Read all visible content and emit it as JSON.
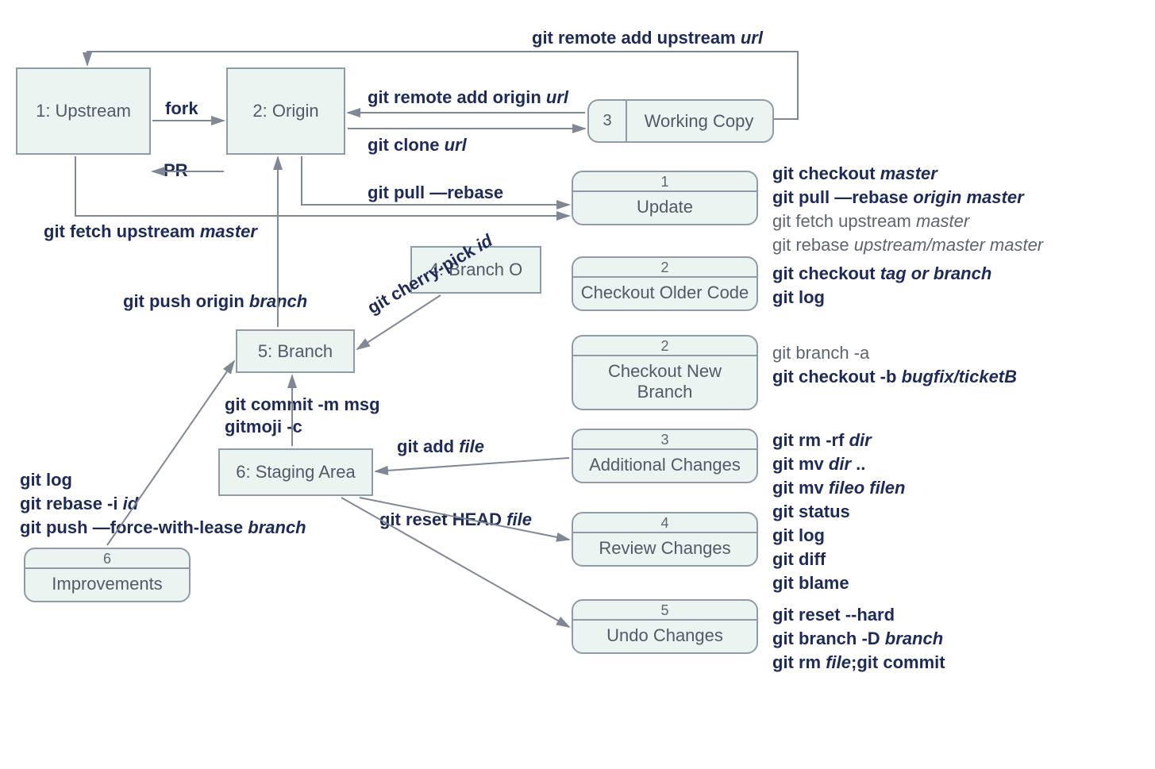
{
  "nodes": {
    "upstream": "1: Upstream",
    "origin": "2: Origin",
    "branchO": "4: Branch O",
    "branch": "5: Branch",
    "staging": "6: Staging Area"
  },
  "wcopy": {
    "num": "3",
    "label": "Working Copy"
  },
  "rightPills": {
    "update": {
      "num": "1",
      "label": "Update"
    },
    "checkoutOld": {
      "num": "2",
      "label": "Checkout Older Code"
    },
    "checkoutNew": {
      "num": "2",
      "label": "Checkout New Branch"
    },
    "addChanges": {
      "num": "3",
      "label": "Additional Changes"
    },
    "reviewChanges": {
      "num": "4",
      "label": "Review Changes"
    },
    "undoChanges": {
      "num": "5",
      "label": "Undo Changes"
    }
  },
  "improvements": {
    "num": "6",
    "label": "Improvements"
  },
  "edge": {
    "remoteUpstream": {
      "cmd": "git remote add upstream ",
      "arg": "url"
    },
    "fork": "fork",
    "remoteOrigin": {
      "cmd": "git remote add origin ",
      "arg": "url"
    },
    "clone": {
      "cmd": "git clone  ",
      "arg": "url"
    },
    "pr": "PR",
    "pullRebase": "git pull —rebase",
    "fetchUpstream": {
      "cmd": "git  fetch upstream ",
      "arg": "master"
    },
    "pushOrigin": {
      "cmd": "git push origin ",
      "arg": "branch"
    },
    "cherryPick": {
      "cmd": "git cherry-pick ",
      "arg": "id"
    },
    "commit1": "git commit -m msg",
    "commit2": "gitmoji -c",
    "gitAdd": {
      "cmd": "git add ",
      "arg": "file"
    },
    "gitReset": {
      "cmd": "git reset HEAD ",
      "arg": "file"
    }
  },
  "side": {
    "update": {
      "l1": {
        "b": "git checkout ",
        "i": "master"
      },
      "l2": {
        "b": "git pull —rebase ",
        "i": "origin master"
      },
      "l3": {
        "pre": "git fetch upstream ",
        "i": "master"
      },
      "l4": {
        "pre": "git rebase ",
        "i": "upstream/master master"
      }
    },
    "checkoutOld": {
      "l1": {
        "b": "git checkout ",
        "i": "tag or branch"
      },
      "l2b": "git log"
    },
    "checkoutNew": {
      "l1g": "git branch -a",
      "l2": {
        "b": "git checkout -b ",
        "i": "bugfix/ticketB"
      }
    },
    "addChanges": {
      "l1": {
        "b": "git rm -rf ",
        "i": "dir"
      },
      "l2": {
        "b": "git mv ",
        "i": "dir",
        "post": " .."
      },
      "l3": {
        "b": "git mv ",
        "i": "fileo filen"
      }
    },
    "review": {
      "l1": "git status",
      "l2": "git log",
      "l3": "git diff",
      "l4": "git blame"
    },
    "undo": {
      "l1b": "git reset --hard",
      "l2": {
        "b": "git branch -D ",
        "i": "branch"
      },
      "l3": {
        "b1": "git rm ",
        "i": "file",
        "b2": ";git commit"
      }
    },
    "improve": {
      "l1b": "git log",
      "l2": {
        "b": "git rebase -i ",
        "i": "id"
      },
      "l3": {
        "b": "git push —force-with-lease ",
        "i": "branch"
      }
    }
  }
}
